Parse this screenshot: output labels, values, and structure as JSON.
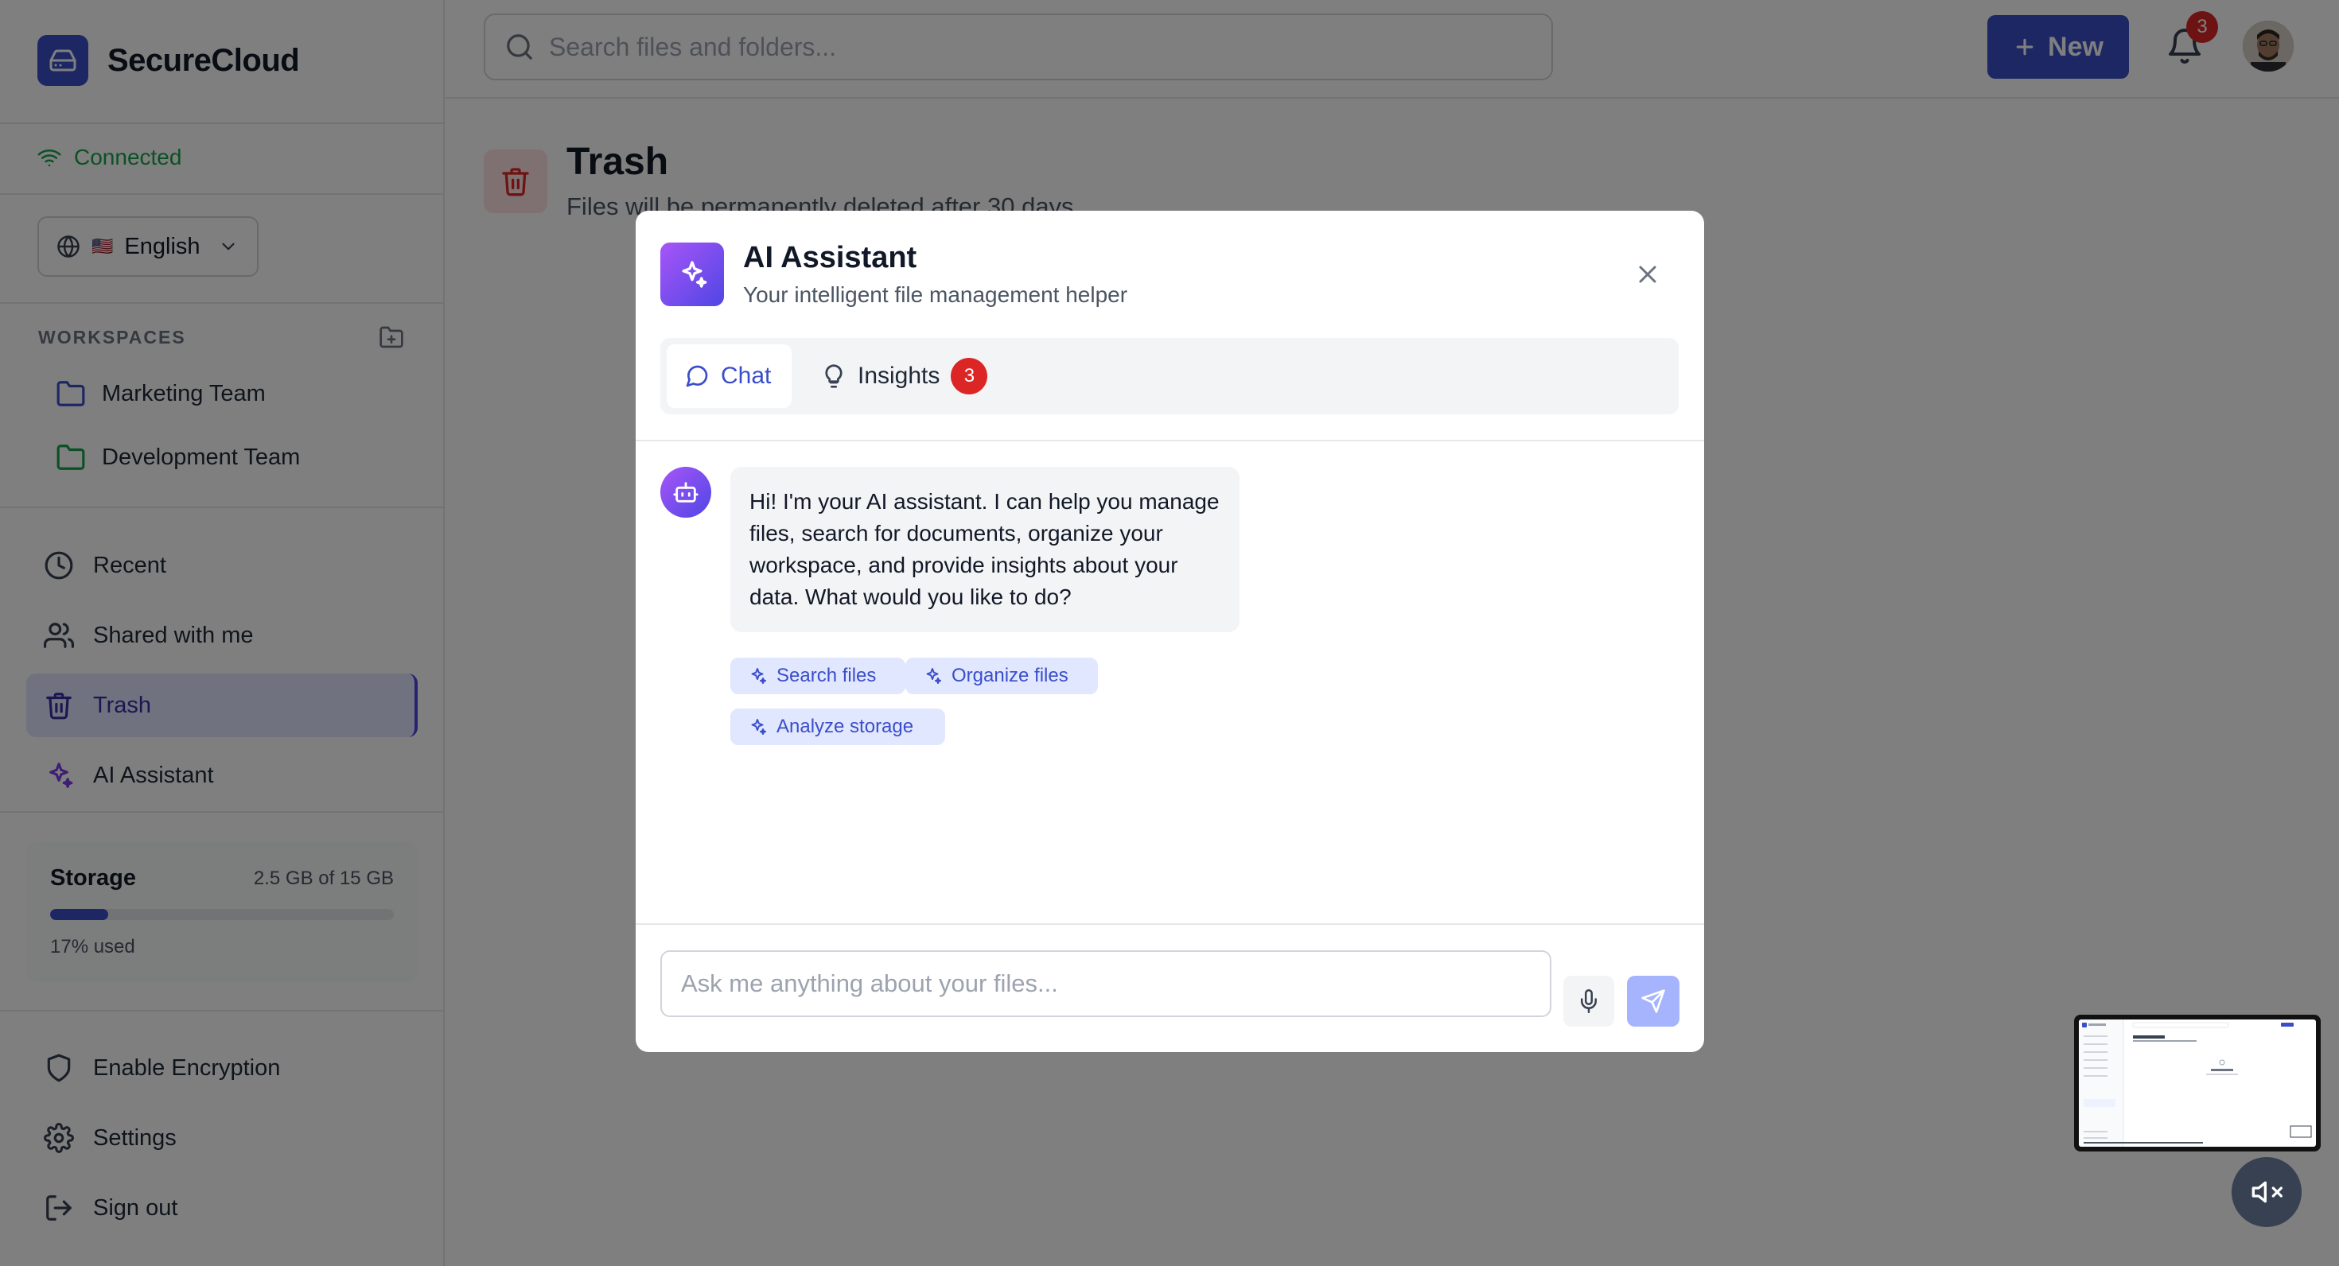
{
  "app": {
    "name": "SecureCloud"
  },
  "status": {
    "connected": "Connected"
  },
  "language": {
    "flag": "🇺🇸",
    "label": "English"
  },
  "workspaces": {
    "title": "WORKSPACES",
    "items": [
      {
        "label": "Marketing Team",
        "color": "#3b4ec9"
      },
      {
        "label": "Development Team",
        "color": "#16a34a"
      }
    ]
  },
  "nav": {
    "recent": "Recent",
    "shared": "Shared with me",
    "trash": "Trash",
    "ai": "AI Assistant"
  },
  "storage": {
    "label": "Storage",
    "amount": "2.5 GB of 15 GB",
    "percent_label": "17% used",
    "fraction": 0.17
  },
  "bottom_nav": {
    "encryption": "Enable Encryption",
    "settings": "Settings",
    "signout": "Sign out"
  },
  "topbar": {
    "search_placeholder": "Search files and folders...",
    "new_label": "New",
    "notification_count": "3"
  },
  "page": {
    "title": "Trash",
    "subtitle": "Files will be permanently deleted after 30 days"
  },
  "modal": {
    "title": "AI Assistant",
    "subtitle": "Your intelligent file management helper",
    "tabs": {
      "chat": "Chat",
      "insights": "Insights",
      "insights_badge": "3"
    },
    "message": "Hi! I'm your AI assistant. I can help you manage files, search for documents, organize your workspace, and provide insights about your data. What would you like to do?",
    "suggestions": [
      "Search files",
      "Organize files",
      "Analyze storage"
    ],
    "input_placeholder": "Ask me anything about your files..."
  },
  "colors": {
    "accent": "#3b4ec9",
    "connected": "#16a34a",
    "danger": "#dc2626"
  }
}
